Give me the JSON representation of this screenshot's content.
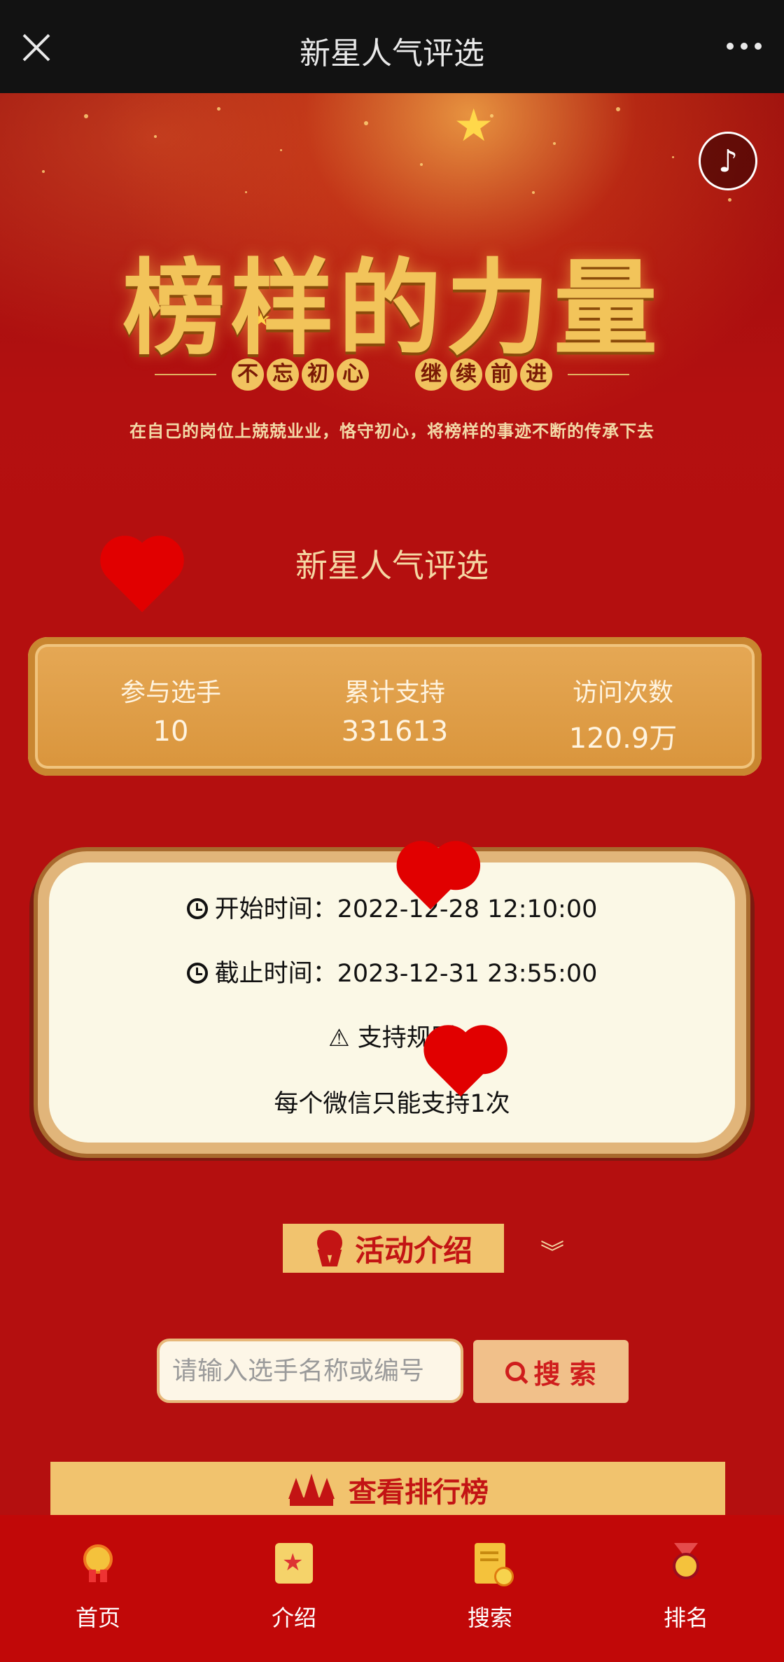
{
  "topbar": {
    "title": "新星人气评选",
    "close_icon": "close-icon",
    "more_icon": "more-icon"
  },
  "hero": {
    "title": "榜样的力量",
    "subtitle_left": [
      "不",
      "忘",
      "初",
      "心"
    ],
    "subtitle_right": [
      "继",
      "续",
      "前",
      "进"
    ],
    "description": "在自己的岗位上兢兢业业，恪守初心，将榜样的事迹不断的传承下去",
    "music_icon": "♪"
  },
  "event_name": "新星人气评选",
  "stats": {
    "participants_label": "参与选手",
    "participants_value": "10",
    "support_label": "累计支持",
    "support_value": "331613",
    "visits_label": "访问次数",
    "visits_value": "120.9万"
  },
  "times": {
    "start_label": "开始时间：",
    "start_value": "2022-12-28 12:10:00",
    "end_label": "截止时间：",
    "end_value": "2023-12-31 23:55:00",
    "rules_title": "支持规则",
    "rules_text": "每个微信只能支持1次"
  },
  "intro": {
    "label": "活动介绍",
    "expand_icon": "︾"
  },
  "search": {
    "placeholder": "请输入选手名称或编号",
    "button_label": "搜 索"
  },
  "rank_button": "查看排行榜",
  "nav": {
    "items": [
      {
        "label": "首页",
        "icon": "medal-icon"
      },
      {
        "label": "介绍",
        "icon": "intro-icon"
      },
      {
        "label": "搜索",
        "icon": "search-doc-icon"
      },
      {
        "label": "排名",
        "icon": "rank-medal-icon"
      }
    ]
  },
  "colors": {
    "primary_red": "#b40f0f",
    "gold": "#f1c36e",
    "nav_red": "#c10808"
  }
}
